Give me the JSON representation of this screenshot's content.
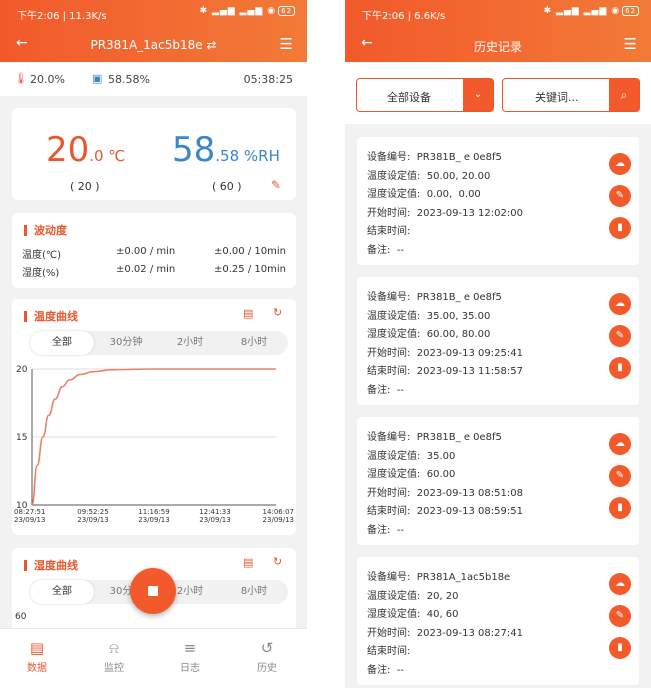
{
  "left": {
    "status": {
      "time_speed": "下午2:06 | 11.3K/s",
      "icons": "✱ ▂▄▆ ▂▄▆ ◉",
      "battery": "62"
    },
    "title": "PR381A_1ac5b18e ⇄",
    "summary": {
      "temp": "20.0%",
      "humidity": "58.58%",
      "clock": "05:38:25"
    },
    "reading": {
      "temp_value": "20",
      "temp_unit": ".0 ℃",
      "temp_set": "( 20 )",
      "hum_value": "58",
      "hum_unit": ".58 %RH",
      "hum_set": "( 60 )"
    },
    "fluct": {
      "title": "波动度",
      "rows": [
        {
          "label": "温度(℃)",
          "min": "±0.00 / min",
          "ten": "±0.00 / 10min"
        },
        {
          "label": "湿度(%)",
          "min": "±0.02 / min",
          "ten": "±0.25 / 10min"
        }
      ]
    },
    "temp_curve": {
      "title": "温度曲线",
      "tabs": [
        "全部",
        "30分钟",
        "2小时",
        "8小时"
      ]
    },
    "hum_curve": {
      "title": "湿度曲线",
      "tabs": [
        "全部",
        "30分钟",
        "2小时",
        "8小时"
      ],
      "y_top": "60"
    },
    "nav": [
      "数据",
      "监控",
      "日志",
      "历史"
    ]
  },
  "chart_data": {
    "type": "line",
    "title": "温度曲线",
    "xlabel": "",
    "ylabel": "",
    "ylim": [
      10,
      20
    ],
    "yticks": [
      "20",
      "15",
      "10"
    ],
    "xticks": [
      {
        "time": "08:27:51",
        "date": "23/09/13"
      },
      {
        "time": "09:52:25",
        "date": "23/09/13"
      },
      {
        "time": "11:16:59",
        "date": "23/09/13"
      },
      {
        "time": "12:41:33",
        "date": "23/09/13"
      },
      {
        "time": "14:06:07",
        "date": "23/09/13"
      }
    ],
    "x": [
      "08:27:51",
      "08:35",
      "08:43",
      "08:51",
      "09:00",
      "09:10",
      "09:20",
      "09:35",
      "09:52:25",
      "10:20",
      "11:16:59",
      "12:41:33",
      "14:06:07"
    ],
    "series": [
      {
        "values": [
          10.0,
          12.9,
          15.0,
          16.6,
          17.8,
          18.7,
          19.2,
          19.6,
          19.8,
          19.95,
          20.0,
          20.0,
          20.0
        ]
      }
    ],
    "color": "#e8826a"
  },
  "right": {
    "status": {
      "time_speed": "下午2:06 | 6.6K/s",
      "icons": "✱ ▂▄▆ ▂▄▆ ◉",
      "battery": "62"
    },
    "title": "历史记录",
    "device_select": "全部设备",
    "keyword_placeholder": "关键词...",
    "records": [
      {
        "lines": [
          "设备编号:  PR381B_ e 0e8f5",
          "温度设定值:  50.00, 20.00",
          "湿度设定值:  0.00,  0.00",
          "开始时间:  2023-09-13 12:02:00",
          "结束时间:",
          "备注:  --"
        ]
      },
      {
        "lines": [
          "设备编号:  PR381B_ e 0e8f5",
          "温度设定值:  35.00, 35.00",
          "湿度设定值:  60.00, 80.00",
          "开始时间:  2023-09-13 09:25:41",
          "结束时间:  2023-09-13 11:58:57",
          "备注:  --"
        ]
      },
      {
        "lines": [
          "设备编号:  PR381B_ e 0e8f5",
          "温度设定值:  35.00",
          "湿度设定值:  60.00",
          "开始时间:  2023-09-13 08:51:08",
          "结束时间:  2023-09-13 08:59:51",
          "备注:  --"
        ]
      },
      {
        "lines": [
          "设备编号:  PR381A_1ac5b18e",
          "温度设定值:  20, 20",
          "湿度设定值:  40, 60",
          "开始时间:  2023-09-13 08:27:41",
          "结束时间:",
          "备注:  --"
        ]
      }
    ]
  },
  "colors": {
    "accent": "#f2592b",
    "blue": "#3a86c8"
  }
}
